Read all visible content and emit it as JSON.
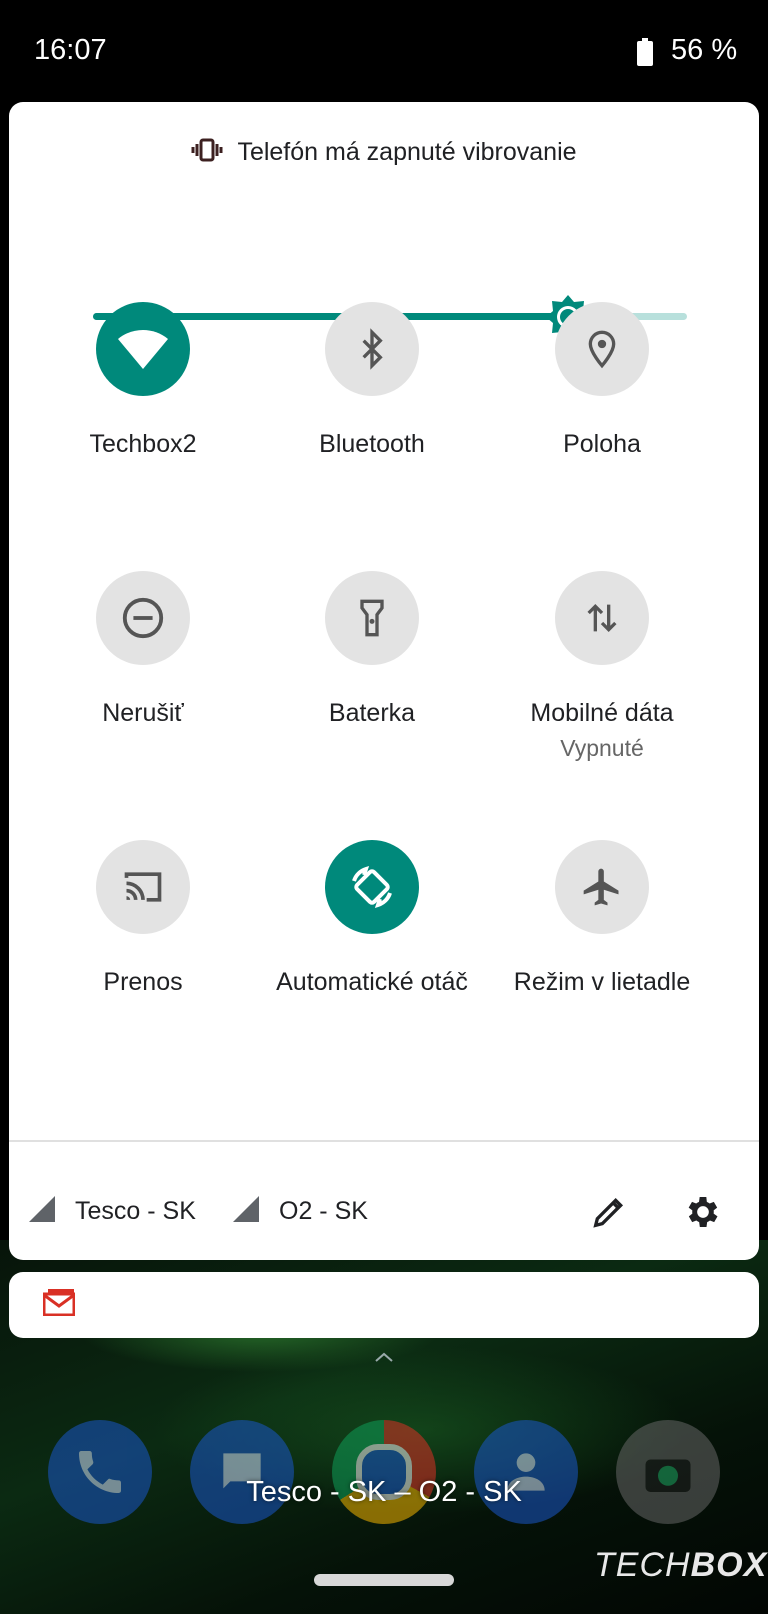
{
  "status_bar": {
    "time": "16:07",
    "battery_percent": "56 %",
    "battery_icon": "battery-icon"
  },
  "ringer": {
    "icon": "vibrate-icon",
    "text": "Telefón má zapnuté vibrovanie"
  },
  "brightness": {
    "icon": "brightness-icon",
    "level": 0.8,
    "accent_color": "#00897b",
    "track_color": "#b8e0dc"
  },
  "tiles": [
    {
      "label": "Techbox2",
      "icon": "wifi-icon",
      "on": true
    },
    {
      "label": "Bluetooth",
      "icon": "bluetooth-icon",
      "on": false
    },
    {
      "label": "Poloha",
      "icon": "location-icon",
      "on": false
    },
    {
      "label": "Nerušiť",
      "icon": "do-not-disturb-icon",
      "on": false
    },
    {
      "label": "Baterka",
      "icon": "flashlight-icon",
      "on": false
    },
    {
      "label": "Mobilné dáta",
      "sublabel": "Vypnuté",
      "icon": "mobile-data-icon",
      "on": false
    },
    {
      "label": "Prenos",
      "icon": "cast-icon",
      "on": false
    },
    {
      "label": "Automatické otáč",
      "icon": "auto-rotate-icon",
      "on": true
    },
    {
      "label": "Režim v lietadle",
      "icon": "airplane-icon",
      "on": false
    }
  ],
  "footer": {
    "carrier1": "Tesco - SK",
    "carrier2": "O2 - SK",
    "edit_icon": "pencil-icon",
    "settings_icon": "gear-icon"
  },
  "notification": {
    "icon": "gmail-icon",
    "color": "#d93025"
  },
  "home": {
    "ticker": "Tesco - SK – O2 - SK",
    "brand_light": "TECH",
    "brand_bold": "BOX",
    "dock_icons": [
      "phone-icon",
      "messages-icon",
      "chrome-icon",
      "contacts-icon",
      "camera-icon"
    ]
  }
}
